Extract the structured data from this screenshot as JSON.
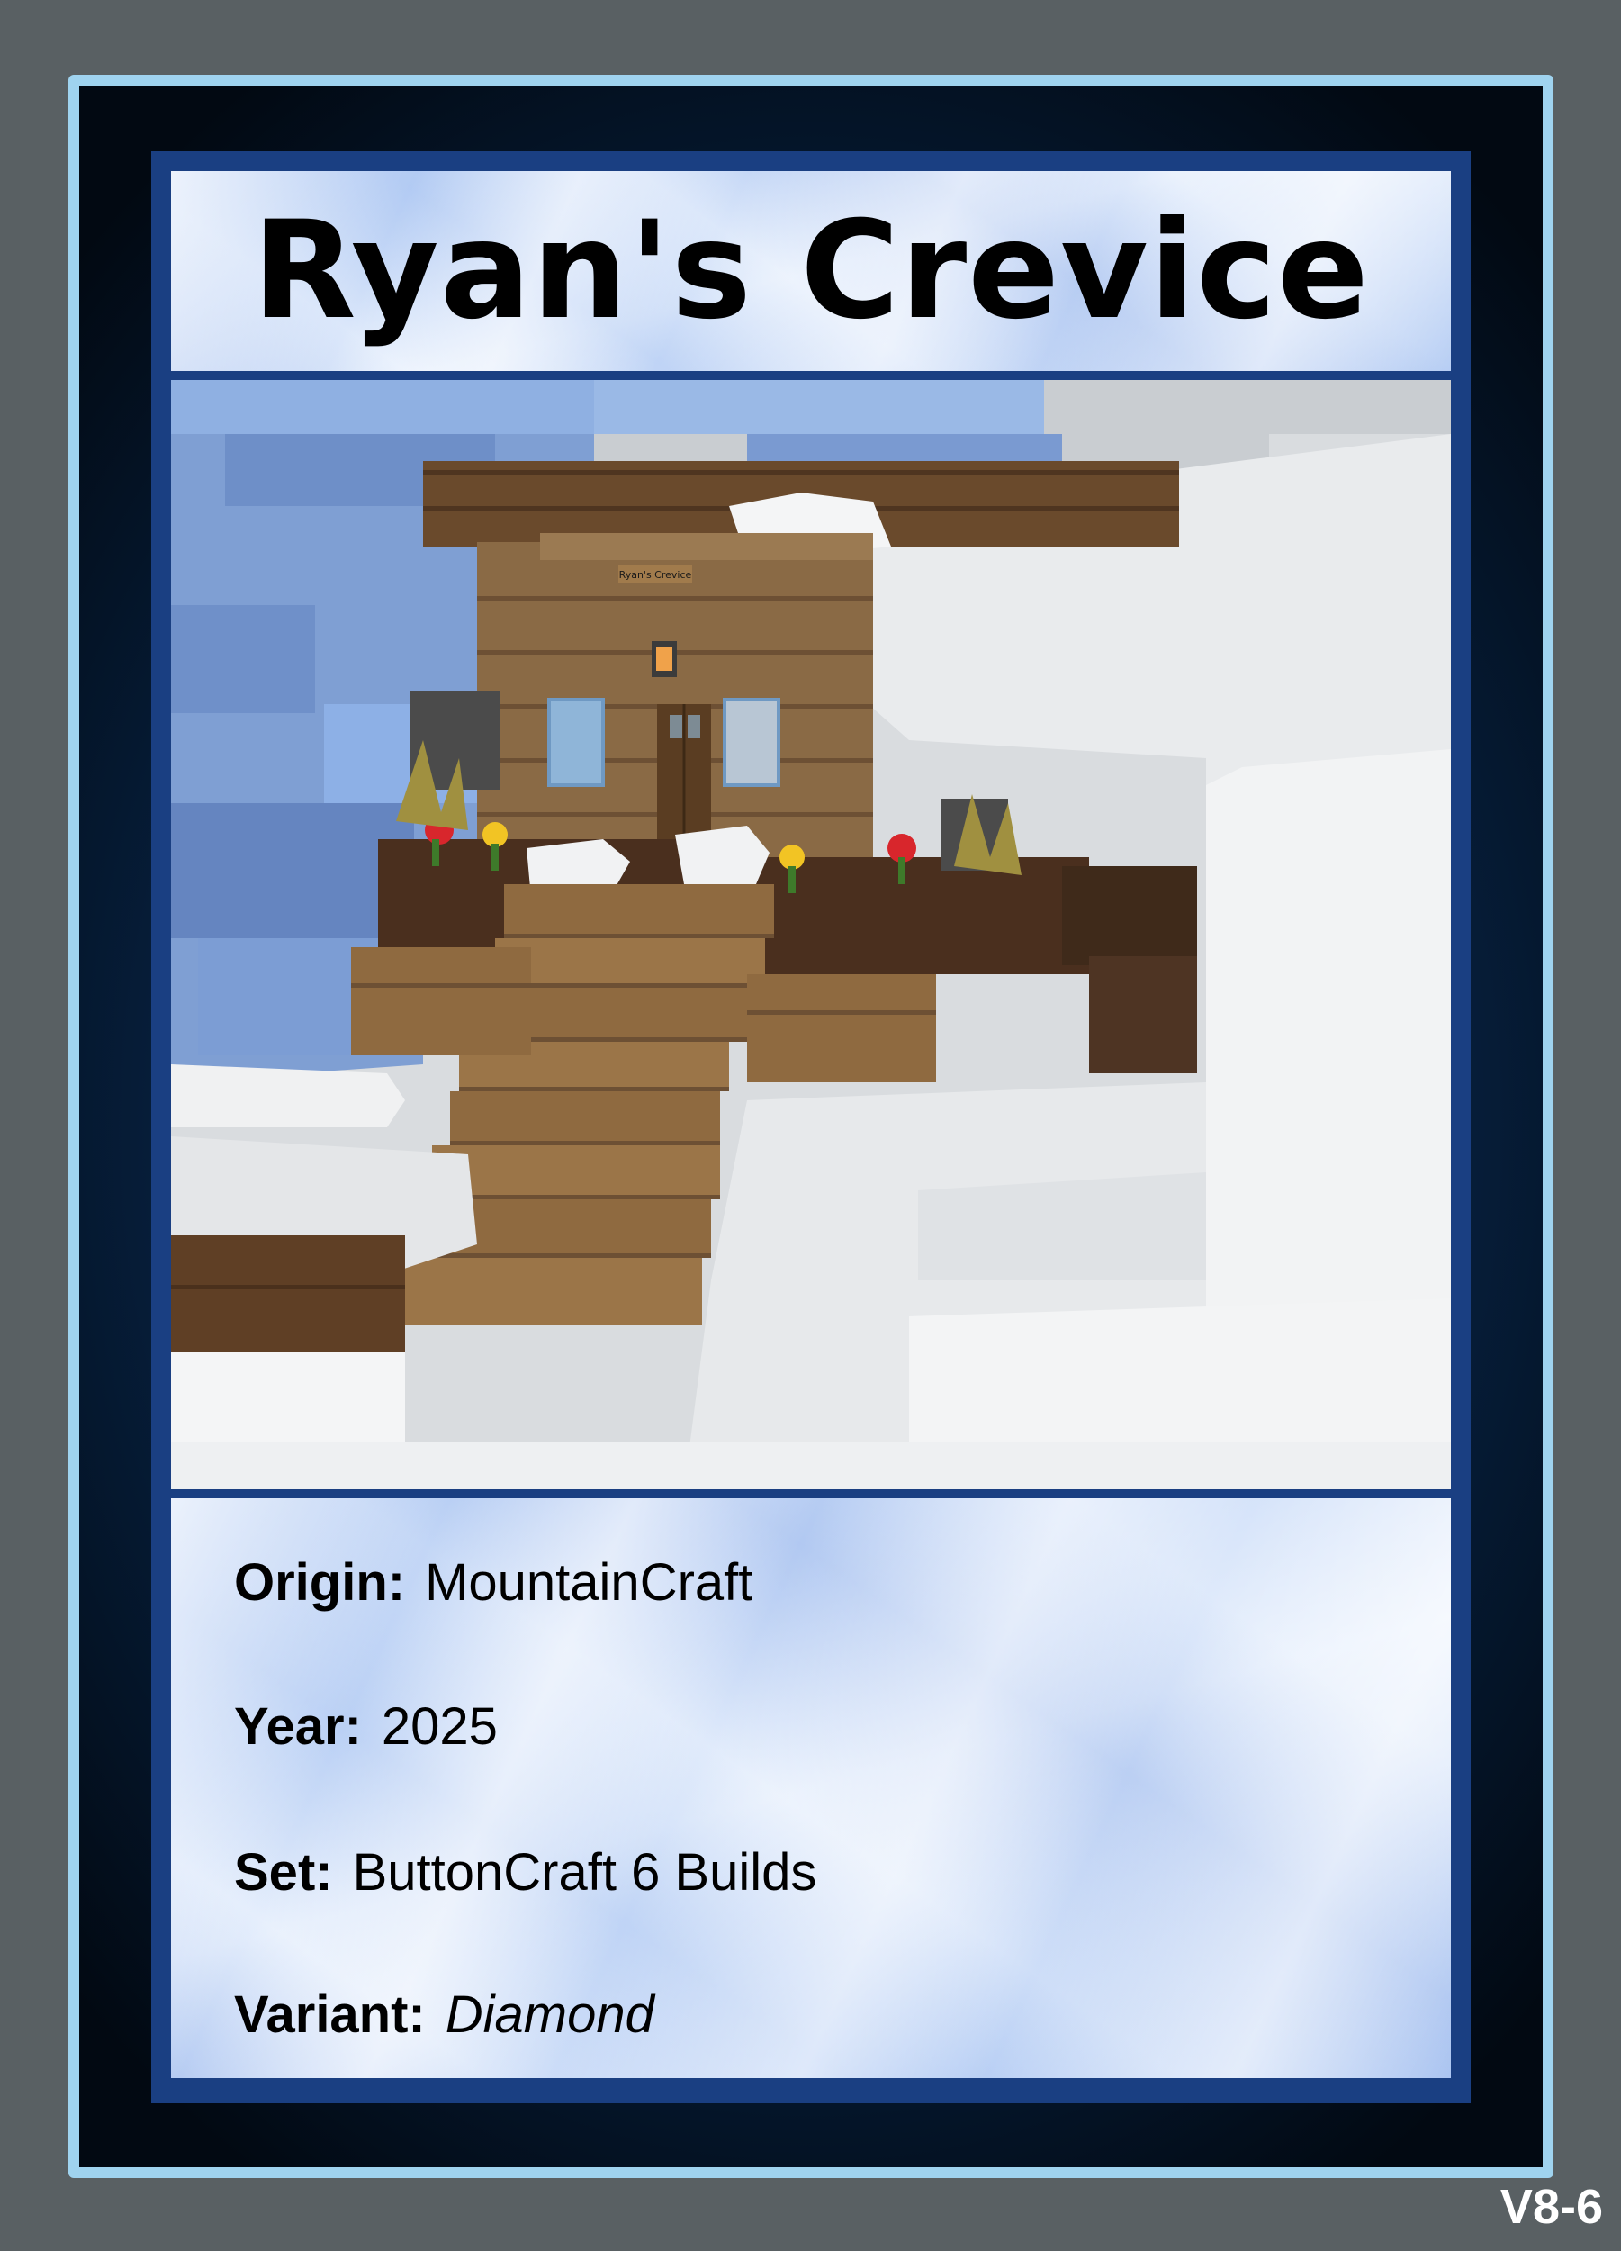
{
  "card": {
    "title": "Ryan's Crevice",
    "code": "V8-6",
    "fields": [
      {
        "label": "Origin:",
        "value": "MountainCraft",
        "italic": false
      },
      {
        "label": "Year:",
        "value": "2025",
        "italic": false
      },
      {
        "label": "Set:",
        "value": "ButtonCraft 6 Builds",
        "italic": false
      },
      {
        "label": "Variant:",
        "value": "Diamond",
        "italic": true
      }
    ],
    "colors": {
      "background": "#596063",
      "border_light": "#9fd3ef",
      "frame_dark": "#08284e",
      "ice_panel": "#d8e6fb"
    }
  },
  "image": {
    "sign_text": "Ryan's Crevice"
  }
}
